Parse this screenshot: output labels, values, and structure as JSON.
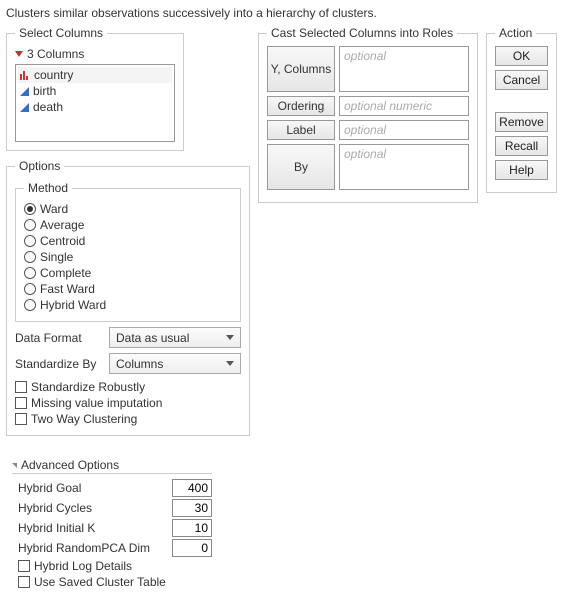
{
  "description": "Clusters similar observations successively into a hierarchy of clusters.",
  "selectColumns": {
    "legend": "Select Columns",
    "count": "3 Columns",
    "items": [
      "country",
      "birth",
      "death"
    ]
  },
  "options": {
    "legend": "Options",
    "method": {
      "legend": "Method",
      "items": [
        "Ward",
        "Average",
        "Centroid",
        "Single",
        "Complete",
        "Fast Ward",
        "Hybrid Ward"
      ],
      "selected": "Ward"
    },
    "dataFormat": {
      "label": "Data Format",
      "value": "Data as usual"
    },
    "standardizeBy": {
      "label": "Standardize By",
      "value": "Columns"
    },
    "checks": [
      "Standardize Robustly",
      "Missing value imputation",
      "Two Way Clustering"
    ]
  },
  "cast": {
    "legend": "Cast Selected Columns into Roles",
    "roles": [
      {
        "name": "Y, Columns",
        "placeholder": "optional",
        "tall": true
      },
      {
        "name": "Ordering",
        "placeholder": "optional numeric"
      },
      {
        "name": "Label",
        "placeholder": "optional"
      },
      {
        "name": "By",
        "placeholder": "optional",
        "tall": true
      }
    ]
  },
  "action": {
    "legend": "Action",
    "primary": [
      "OK",
      "Cancel"
    ],
    "secondary": [
      "Remove",
      "Recall",
      "Help"
    ]
  },
  "advanced": {
    "legend": "Advanced Options",
    "rows": [
      {
        "label": "Hybrid Goal",
        "value": "400"
      },
      {
        "label": "Hybrid Cycles",
        "value": "30"
      },
      {
        "label": "Hybrid Initial K",
        "value": "10"
      },
      {
        "label": "Hybrid RandomPCA Dim",
        "value": "0"
      }
    ],
    "checks": [
      "Hybrid Log Details",
      "Use Saved Cluster Table"
    ]
  }
}
